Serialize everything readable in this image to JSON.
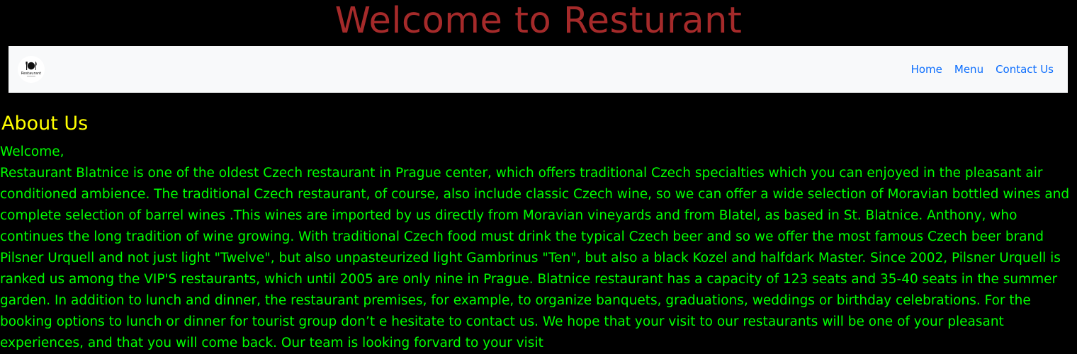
{
  "header": {
    "title": "Welcome to Resturant"
  },
  "navbar": {
    "logo_text": "Restaurant",
    "links": [
      {
        "label": "Home"
      },
      {
        "label": "Menu"
      },
      {
        "label": "Contact Us"
      }
    ]
  },
  "about": {
    "heading": "About Us",
    "greeting": "Welcome,",
    "body": "Restaurant Blatnice is one of the oldest Czech restaurant in Prague center, which offers traditional Czech specialties which you can enjoyed in the pleasant air conditioned ambience. The traditional Czech restaurant, of course, also include classic Czech wine, so we can offer a wide selection of Moravian bottled wines and complete selection of barrel wines .This wines are imported by us directly from Moravian vineyards and from Blatel, as based in St. Blatnice. Anthony, who continues the long tradition of wine growing. With traditional Czech food must drink the typical Czech beer and so we offer the most famous Czech beer brand Pilsner Urquell and not just light \"Twelve\", but also unpasteurized light Gambrinus \"Ten\", but also a black Kozel and halfdark Master. Since 2002, Pilsner Urquell is ranked us among the VIP'S restaurants, which until 2005 are only nine in Prague. Blatnice restaurant has a capacity of 123 seats and 35-40 seats in the summer garden. In addition to lunch and dinner, the restaurant premises, for example, to organize banquets, graduations, weddings or birthday celebrations. For the booking options to lunch or dinner for tourist group don’t e hesitate to contact us. We hope that your visit to our restaurants will be one of your pleasant experiences, and that you will come back. Our team is looking forvard to your visit"
  },
  "colors": {
    "background": "#000000",
    "title": "#a52a2a",
    "heading": "#ffff00",
    "body_text": "#00ff00",
    "nav_link": "#0d6efd",
    "navbar_bg": "#f8f9fa"
  }
}
